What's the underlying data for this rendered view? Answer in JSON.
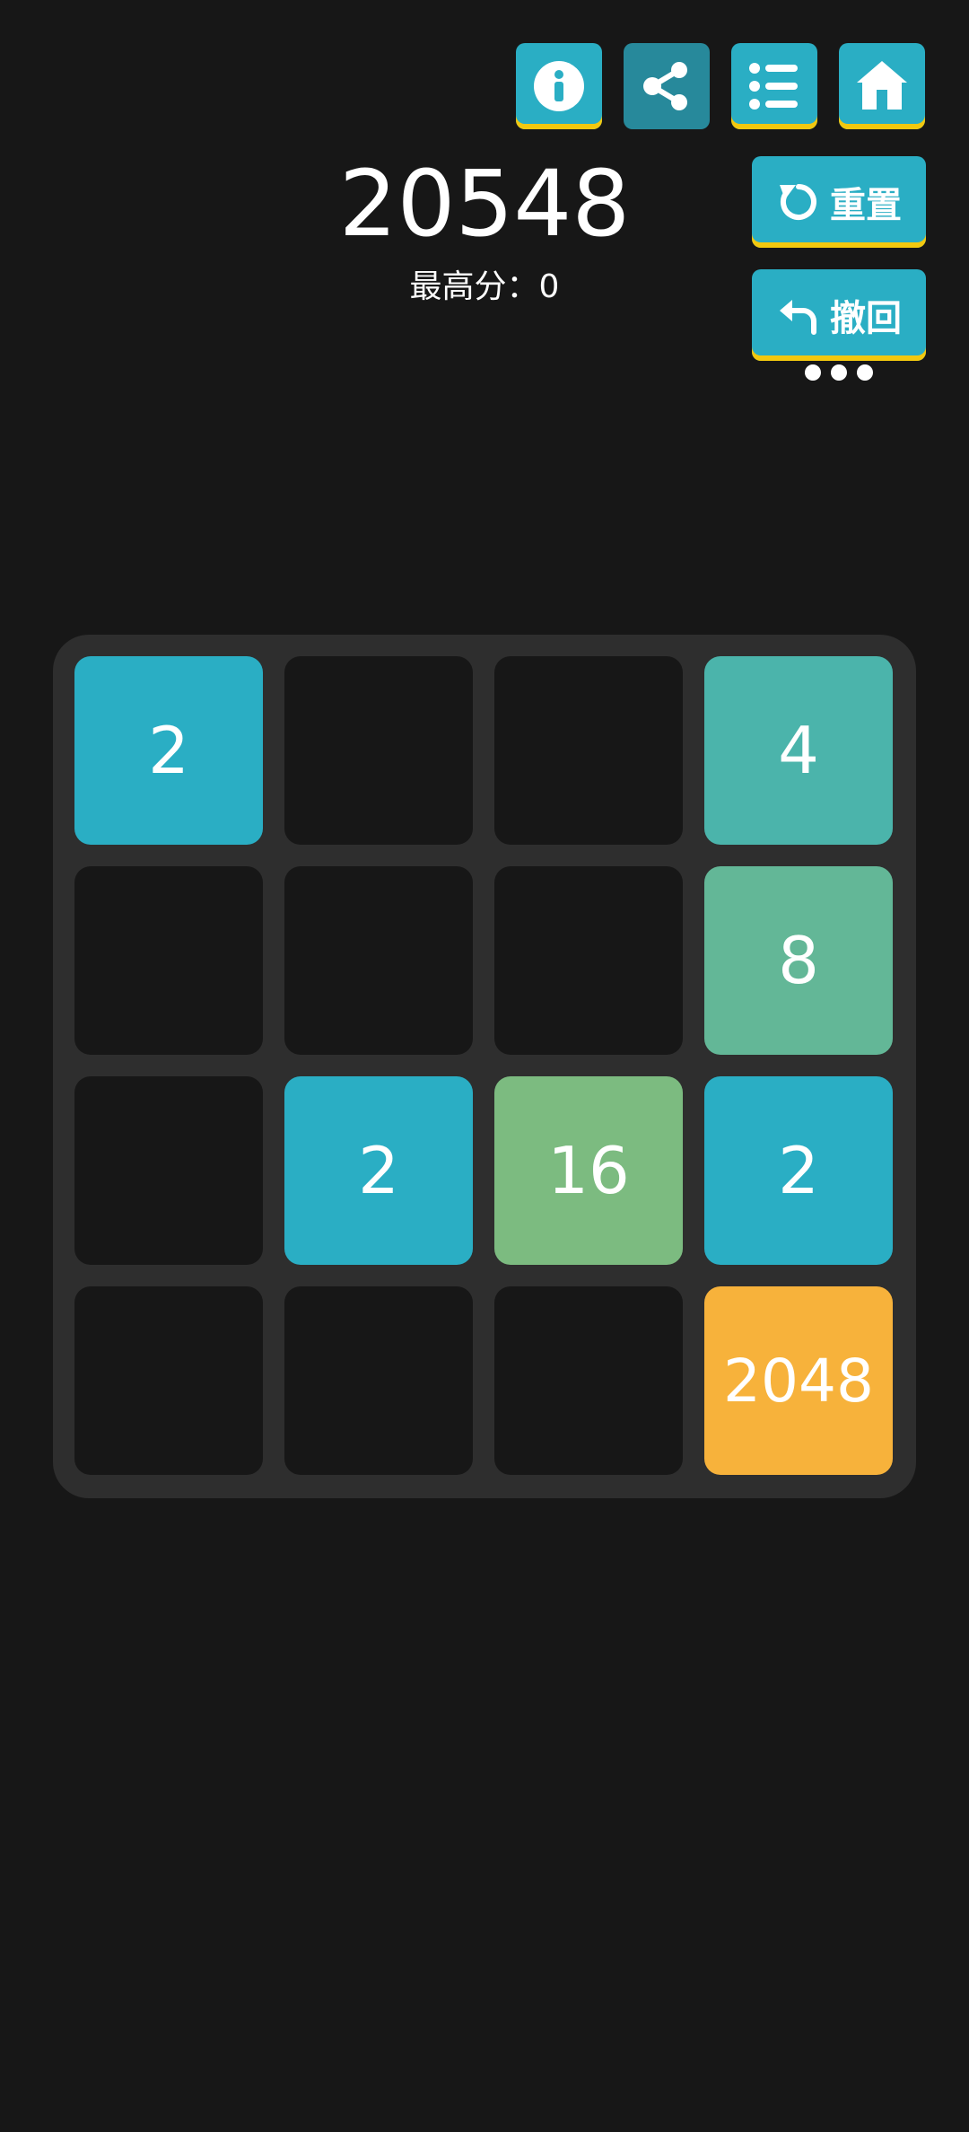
{
  "toolbar": {
    "icons": [
      "info-icon",
      "share-icon",
      "list-icon",
      "home-icon"
    ]
  },
  "score": {
    "current": "20548",
    "best_label": "最高分：0"
  },
  "actions": {
    "reset_label": "重置",
    "undo_label": "撤回"
  },
  "colors": {
    "background": "#171717",
    "board": "#2e2e2e",
    "empty_cell": "#171717",
    "button": "#2aaec4",
    "button_active": "#27899b",
    "button_underline": "#f2c80f",
    "tile_2": "#2aaec4",
    "tile_4": "#4bb4ab",
    "tile_8": "#63b797",
    "tile_16": "#7cbb80",
    "tile_2048": "#f7b23b"
  },
  "board": {
    "rows": [
      [
        "2",
        "",
        "",
        "4"
      ],
      [
        "",
        "",
        "",
        "8"
      ],
      [
        "",
        "2",
        "16",
        "2"
      ],
      [
        "",
        "",
        "",
        "2048"
      ]
    ]
  }
}
